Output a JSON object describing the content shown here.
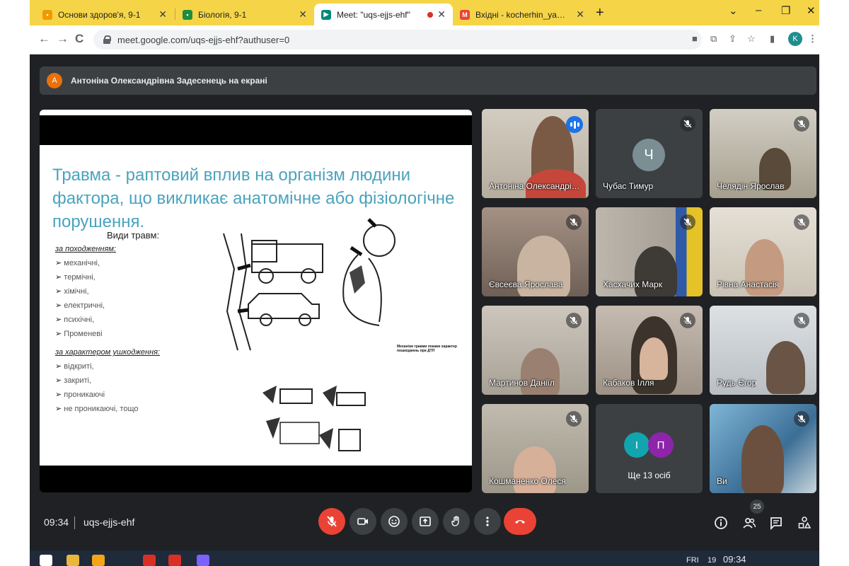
{
  "browser": {
    "tabs": [
      {
        "title": "Основи здоров'я, 9-1",
        "favicon": "classroom-icon",
        "color": "#f29900",
        "active": false
      },
      {
        "title": "Біологія, 9-1",
        "favicon": "classroom-icon",
        "color": "#1e8e3e",
        "active": false
      },
      {
        "title": "Meet: \"uqs-ejjs-ehf\"",
        "favicon": "meet-icon",
        "color": "#00897b",
        "active": true,
        "recording": true
      },
      {
        "title": "Вхідні - kocherhin_ya@fel.ukr.edu.ua",
        "favicon": "gmail-icon",
        "color": "#ea4335",
        "active": false
      }
    ],
    "new_tab": "+",
    "window_controls": {
      "minimize": "–",
      "restore": "❐",
      "close": "✕",
      "tab_search": "⌄"
    },
    "nav": {
      "back": "←",
      "forward": "→",
      "reload": "C"
    },
    "url": "meet.google.com/uqs-ejjs-ehf?authuser=0",
    "profile_initial": "K"
  },
  "meet": {
    "banner": {
      "avatar_letter": "A",
      "text": "Антоніна Олександрівна Задесенець на екрані"
    },
    "slide": {
      "title": "Травма - раптовий вплив на організм людини фактора, що викликає анатомічне або фізіологічне порушення.",
      "types_heading": "Види травм:",
      "origin_heading": "за походженням:",
      "origin_items": [
        "механічні,",
        "термічні,",
        "хімічні,",
        "електричні,",
        "психічні,",
        "Променеві"
      ],
      "character_heading": "за характером ушкодження:",
      "character_items": [
        "відкриті,",
        "закриті,",
        "проникаючі",
        "не проникаючі, тощо"
      ],
      "note": "Механізм травми покаже характер пошкоджень при ДТП"
    },
    "participants": [
      {
        "name": "Антоніна Олександрівна",
        "speaking": true,
        "bg": "#c9c2b5",
        "person": "#7a5a45"
      },
      {
        "name": "Чубас Тимур",
        "avatar_letter": "Ч",
        "muted": true
      },
      {
        "name": "Челядін Ярослав",
        "muted": true,
        "bg": "#b9b3a3",
        "person": "#5a4a3a"
      },
      {
        "name": "Євсеєва Ярослава",
        "muted": true,
        "bg": "#8e7e72",
        "person": "#c8b4a0"
      },
      {
        "name": "Хасхачих Марк",
        "muted": true,
        "bg": "#a7a198",
        "person": "#3e3a36"
      },
      {
        "name": "Рівна Анастасія",
        "muted": true,
        "bg": "#d8d2c4",
        "person": "#c49a80"
      },
      {
        "name": "Мартинов Даніїл",
        "muted": true,
        "bg": "#bfb8ae",
        "person": "#9a8070"
      },
      {
        "name": "Кабаков Ілля",
        "muted": true,
        "bg": "#b7ada2",
        "person": "#3b332c"
      },
      {
        "name": "Рудь Єгор",
        "muted": true,
        "bg": "#cfd3d6",
        "person": "#6a5446"
      },
      {
        "name": "Кошманенко Олеся",
        "muted": true,
        "bg": "#b6b0a4",
        "person": "#d7b09a"
      },
      {
        "name": "Ще 13 осіб",
        "more": true,
        "avatars": [
          {
            "letter": "І",
            "color": "#12a4af"
          },
          {
            "letter": "П",
            "color": "#8e24aa"
          }
        ]
      },
      {
        "name": "Ви",
        "muted": true,
        "bg": "#6fa3c9",
        "person": "#6b5040"
      }
    ],
    "bottom": {
      "time": "09:34",
      "meeting_code": "uqs-ejjs-ehf",
      "participants_count": "25"
    }
  },
  "taskbar": {
    "day": "FRI",
    "date": "19",
    "time": "09:34"
  }
}
